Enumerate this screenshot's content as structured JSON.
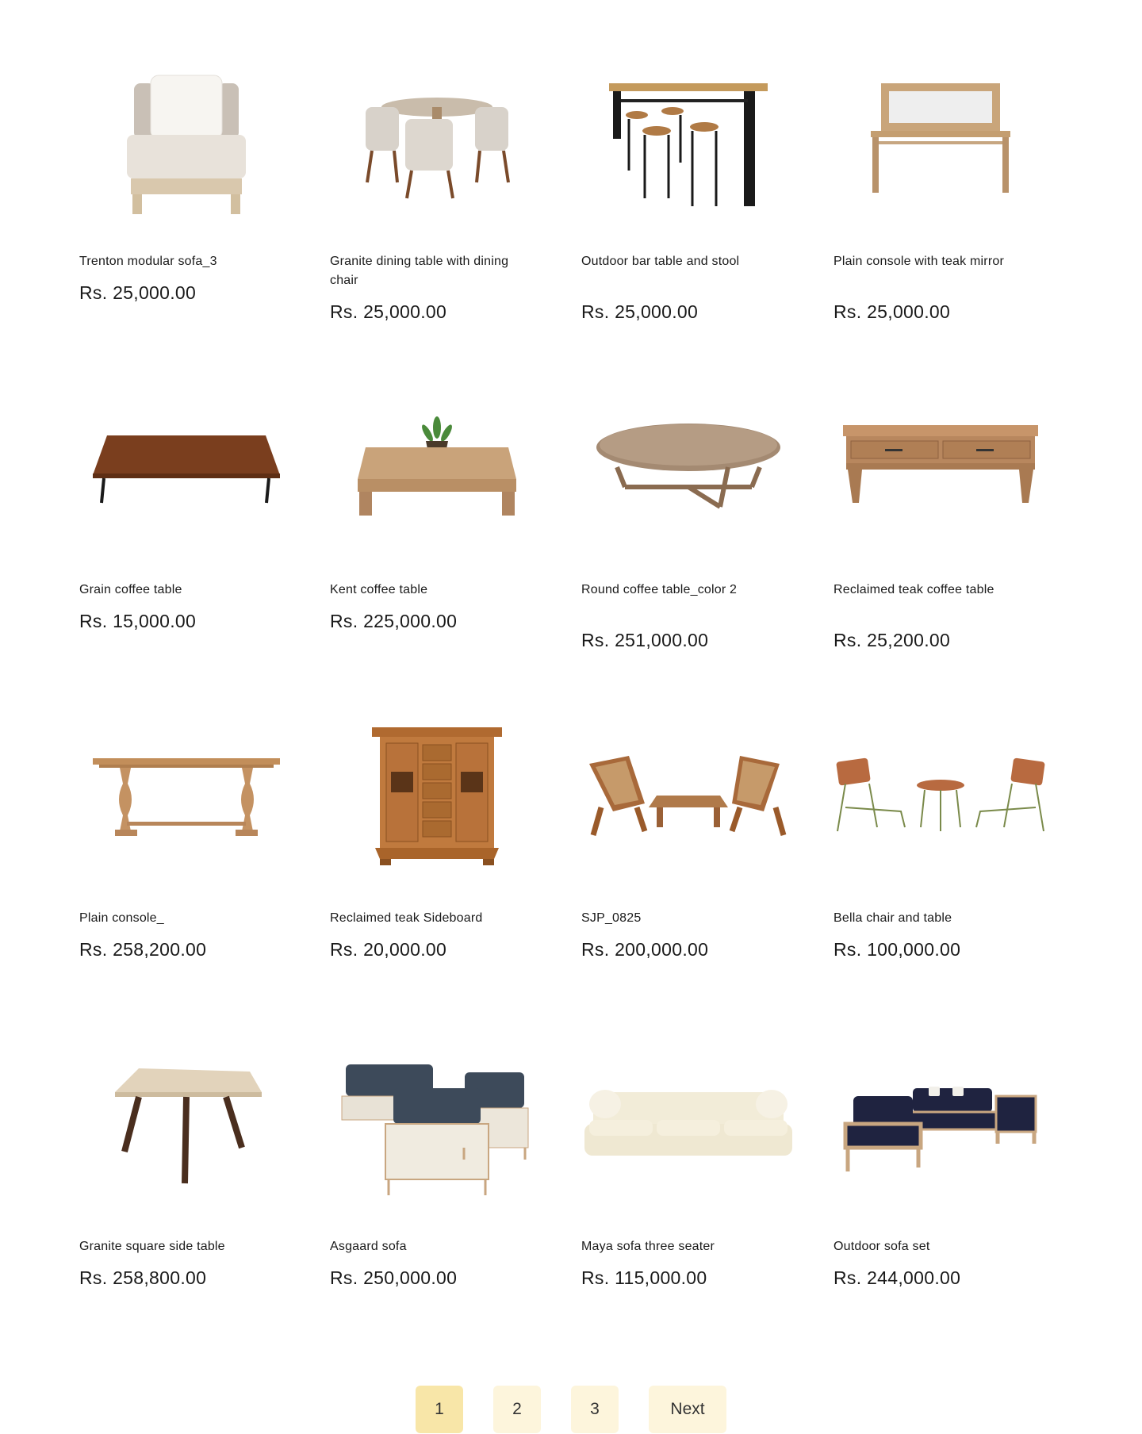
{
  "products": [
    {
      "name": "Trenton modular sofa_3",
      "price": "Rs. 25,000.00",
      "image": "modular-sofa-image"
    },
    {
      "name": "Granite dining table with dining chair",
      "price": "Rs. 25,000.00",
      "image": "dining-set-image"
    },
    {
      "name": "Outdoor bar table and stool",
      "price": "Rs. 25,000.00",
      "image": "bar-table-image"
    },
    {
      "name": "Plain console with teak mirror",
      "price": "Rs. 25,000.00",
      "image": "console-mirror-image"
    },
    {
      "name": "Grain coffee table",
      "price": "Rs. 15,000.00",
      "image": "grain-coffee-table-image"
    },
    {
      "name": "Kent coffee table",
      "price": "Rs. 225,000.00",
      "image": "kent-coffee-table-image"
    },
    {
      "name": "Round coffee table_color 2",
      "price": "Rs. 251,000.00",
      "image": "round-coffee-table-image"
    },
    {
      "name": "Reclaimed teak coffee table",
      "price": "Rs. 25,200.00",
      "image": "teak-coffee-table-image"
    },
    {
      "name": "Plain console_",
      "price": "Rs. 258,200.00",
      "image": "plain-console-image"
    },
    {
      "name": "Reclaimed teak Sideboard",
      "price": "Rs. 20,000.00",
      "image": "teak-sideboard-image"
    },
    {
      "name": "SJP_0825",
      "price": "Rs. 200,000.00",
      "image": "lounge-set-image"
    },
    {
      "name": "Bella chair and table",
      "price": "Rs. 100,000.00",
      "image": "bella-set-image"
    },
    {
      "name": "Granite square side table",
      "price": "Rs. 258,800.00",
      "image": "side-table-image"
    },
    {
      "name": "Asgaard sofa",
      "price": "Rs. 250,000.00",
      "image": "asgaard-sofa-image"
    },
    {
      "name": "Maya sofa three seater",
      "price": "Rs. 115,000.00",
      "image": "maya-sofa-image"
    },
    {
      "name": "Outdoor sofa set",
      "price": "Rs. 244,000.00",
      "image": "outdoor-sofa-image"
    }
  ],
  "pagination": {
    "pages": [
      "1",
      "2",
      "3"
    ],
    "current": "1",
    "next_label": "Next"
  },
  "colors": {
    "page_active_bg": "#f8e6a8",
    "page_bg": "#fdf5dc"
  }
}
